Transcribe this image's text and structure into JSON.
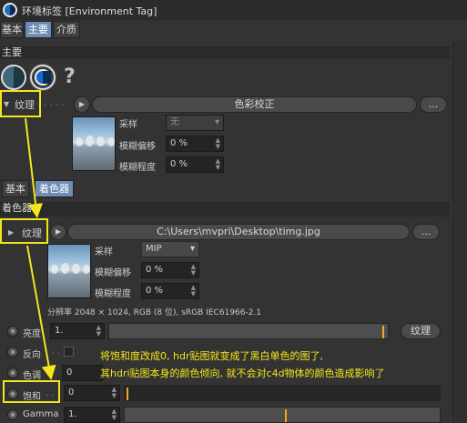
{
  "window": {
    "title": "环境标签 [Environment Tag]"
  },
  "tabs_top": [
    {
      "label": "基本",
      "active": false
    },
    {
      "label": "主要",
      "active": true
    },
    {
      "label": "介质",
      "active": false
    }
  ],
  "main_section": {
    "label": "主要",
    "help_glyph": "?",
    "texture_label": "纹理",
    "texture_dots": ". . . .",
    "color_correction_label": "色彩校正",
    "more_label": "...",
    "sampling_label": "采样",
    "sampling_value": "无",
    "blur_offset_label": "模糊偏移",
    "blur_offset_value": "0 %",
    "blur_degree_label": "模糊程度",
    "blur_degree_value": "0 %"
  },
  "tabs_sub": [
    {
      "label": "基本",
      "active": false
    },
    {
      "label": "着色器",
      "active": true
    }
  ],
  "shader_section": {
    "label": "着色器",
    "texture_label": "纹理",
    "file_path": "C:\\Users\\mvpri\\Desktop\\timg.jpg",
    "more_label": "...",
    "sampling_label": "采样",
    "sampling_value": "MIP",
    "blur_offset_label": "模糊偏移",
    "blur_offset_value": "0 %",
    "blur_degree_label": "模糊程度",
    "blur_degree_value": "0 %",
    "resolution_text": "分辨率 2048 × 1024, RGB (8 位), sRGB IEC61966-2.1"
  },
  "params": [
    {
      "label": "亮度",
      "value": "1.",
      "extra": "纹理"
    },
    {
      "label": "反向",
      "dots": ". . ."
    },
    {
      "label": "色调",
      "value": "0"
    },
    {
      "label": "饱和",
      "dots": ". .",
      "value": "0"
    },
    {
      "label": "Gamma",
      "value": "1."
    }
  ],
  "annotation": {
    "line1": "将饱和度改成0, hdr贴图就变成了黑白单色的图了,",
    "line2": "其hdri贴图本身的颜色倾向, 就不会对c4d物体的颜色造成影响了"
  },
  "colors": {
    "annotation": "#f5e51c",
    "active_tab": "#6e8cb4",
    "slider_marker": "#f5a623",
    "panel_bg": "#333333"
  }
}
